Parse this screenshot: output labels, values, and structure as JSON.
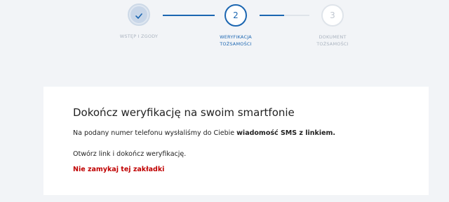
{
  "stepper": {
    "steps": [
      {
        "label_line1": "WSTĘP I ZGODY",
        "label_line2": "",
        "status": "completed",
        "icon": "check-icon"
      },
      {
        "number": "2",
        "label_line1": "WERYFIKACJA",
        "label_line2": "TOŻSAMOŚCI",
        "status": "active"
      },
      {
        "number": "3",
        "label_line1": "DOKUMENT",
        "label_line2": "TOŻSAMOŚCI",
        "status": "pending"
      }
    ]
  },
  "card": {
    "title": "Dokończ weryfikację na swoim smartfonie",
    "message_prefix": "Na podany numer telefonu wysłaliśmy do Ciebie ",
    "message_bold": "wiadomość SMS z linkiem.",
    "instruction": "Otwórz link i dokończ weryfikację.",
    "warning": "Nie zamykaj tej zakładki"
  },
  "colors": {
    "accent": "#1b66b1",
    "warning": "#c00000",
    "background": "#f2f4f7"
  }
}
